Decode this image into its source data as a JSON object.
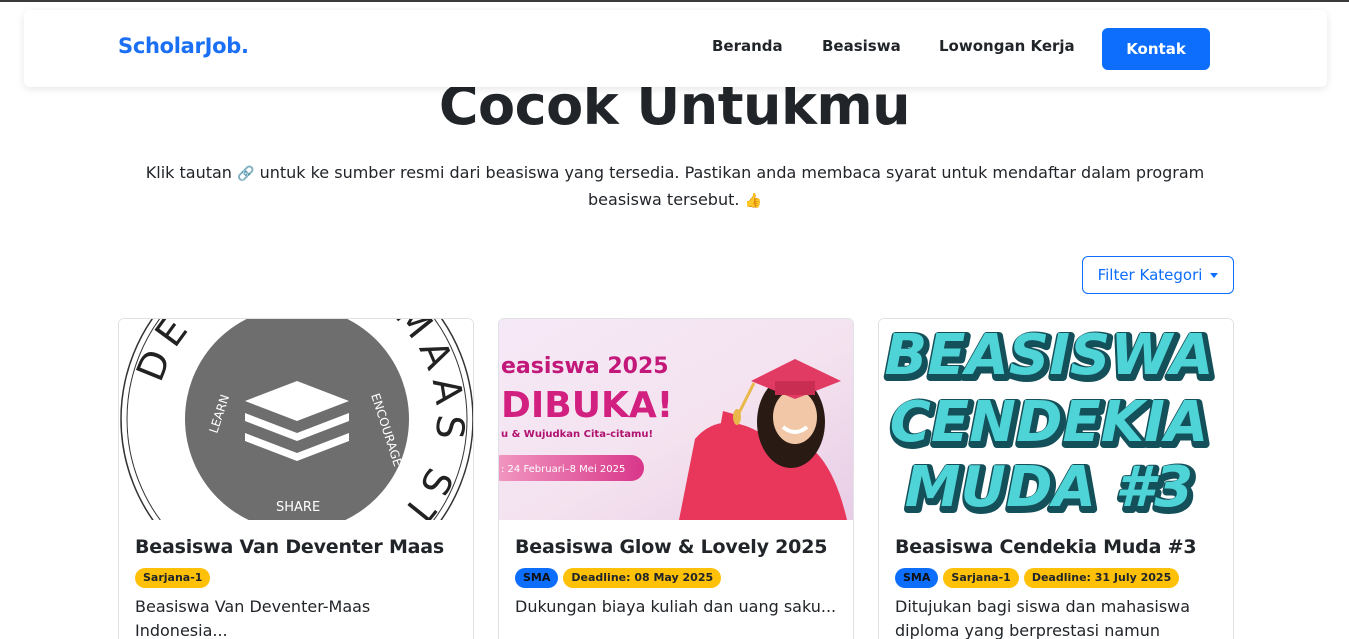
{
  "brand": {
    "name": "ScholarJob.",
    "color": "#1a6ff5"
  },
  "nav": {
    "items": [
      {
        "label": "Beranda"
      },
      {
        "label": "Beasiswa"
      },
      {
        "label": "Lowongan Kerja"
      }
    ],
    "contact_label": "Kontak"
  },
  "hero": {
    "title": "Cocok Untukmu",
    "desc_part1": "Klik tautan",
    "link_emoji": "🔗",
    "desc_part2": "untuk ke sumber resmi dari beasiswa yang tersedia. Pastikan anda membaca syarat untuk mendaftar dalam program beasiswa tersebut.",
    "thumb_emoji": "👍"
  },
  "filter": {
    "label": "Filter Kategori"
  },
  "cards": [
    {
      "title": "Beasiswa Van Deventer Maas",
      "badges": [
        "Sarjana-1"
      ],
      "text": "Beasiswa Van Deventer-Maas Indonesia...",
      "image": {
        "ring_text": "DEVENTER MAAS STICHTING",
        "words": [
          "LEARN",
          "ENCOURAGE",
          "SHARE"
        ],
        "icon": "layers-icon"
      }
    },
    {
      "title": "Beasiswa Glow & Lovely 2025",
      "badges": [
        "SMA",
        "Deadline: 08 May 2025"
      ],
      "text": "Dukungan biaya kuliah dan uang saku...",
      "image": {
        "line1": "easiswa 2025",
        "line2": "DIBUKA!",
        "line3": "u & Wujudkan Cita-citamu!",
        "line4": ": 24 Februari–8 Mei 2025"
      }
    },
    {
      "title": "Beasiswa Cendekia Muda #3",
      "badges": [
        "SMA",
        "Sarjana-1",
        "Deadline: 31 July 2025"
      ],
      "text": "Ditujukan bagi siswa dan mahasiswa diploma yang berprestasi namun",
      "image": {
        "line1": "BEASISWA",
        "line2": "CENDEKIA",
        "line3": "MUDA #3"
      }
    }
  ],
  "colors": {
    "primary": "#0d6efd",
    "warning": "#ffc107",
    "text": "#212529"
  }
}
